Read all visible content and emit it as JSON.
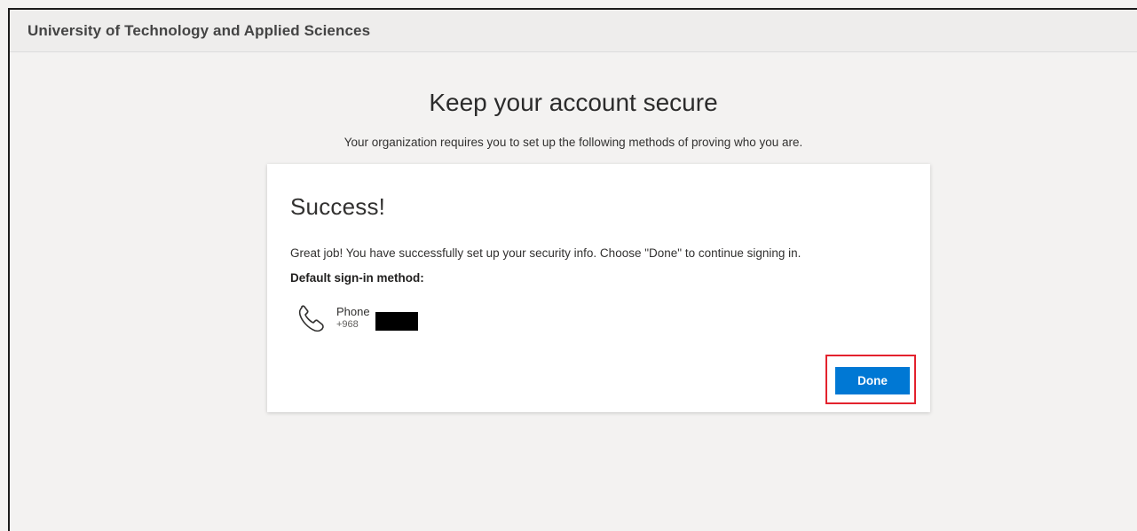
{
  "header": {
    "org_name": "University of Technology and Applied Sciences"
  },
  "page": {
    "title": "Keep your account secure",
    "subtitle": "Your organization requires you to set up the following methods of proving who you are."
  },
  "card": {
    "title": "Success!",
    "message": "Great job! You have successfully set up your security info. Choose \"Done\" to continue signing in.",
    "default_label": "Default sign-in method:",
    "method": {
      "icon": "phone-icon",
      "name": "Phone",
      "number": "+968"
    },
    "done_label": "Done"
  },
  "colors": {
    "accent": "#0078d4",
    "highlight_border": "#e3222d"
  }
}
